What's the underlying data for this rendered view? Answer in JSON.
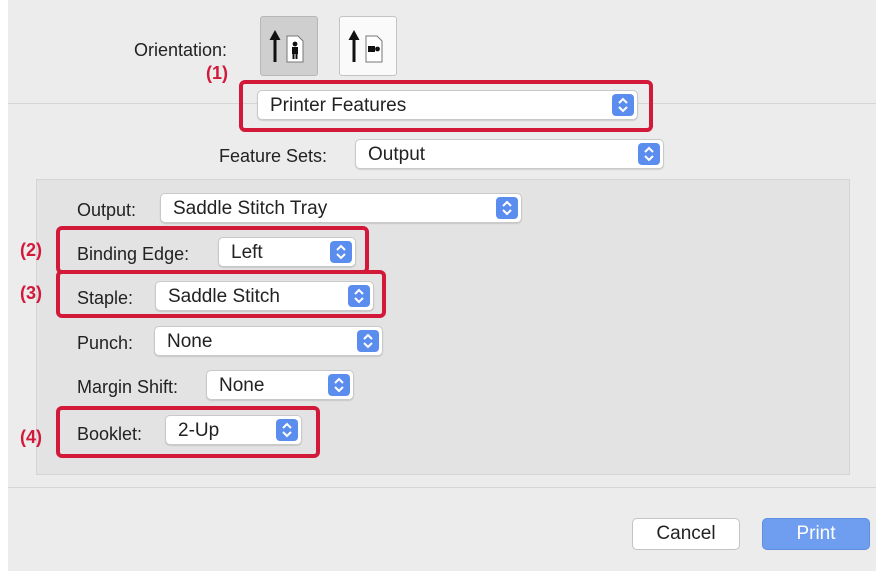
{
  "orientation": {
    "label": "Orientation:",
    "options": [
      {
        "name": "portrait-icon",
        "selected": true
      },
      {
        "name": "landscape-icon",
        "selected": false
      }
    ]
  },
  "callouts": [
    "(1)",
    "(2)",
    "(3)",
    "(4)"
  ],
  "section_popup": {
    "value": "Printer Features"
  },
  "feature_sets": {
    "label": "Feature Sets:",
    "value": "Output"
  },
  "output": {
    "label": "Output:",
    "value": "Saddle Stitch Tray"
  },
  "binding_edge": {
    "label": "Binding Edge:",
    "value": "Left"
  },
  "staple": {
    "label": "Staple:",
    "value": "Saddle Stitch"
  },
  "punch": {
    "label": "Punch:",
    "value": "None"
  },
  "margin_shift": {
    "label": "Margin Shift:",
    "value": "None"
  },
  "booklet": {
    "label": "Booklet:",
    "value": "2-Up"
  },
  "buttons": {
    "cancel": "Cancel",
    "print": "Print"
  },
  "colors": {
    "accent": "#5b8def",
    "callout": "#d3193a",
    "print_button": "#6f9ef0",
    "dialog_background": "#ececec"
  }
}
